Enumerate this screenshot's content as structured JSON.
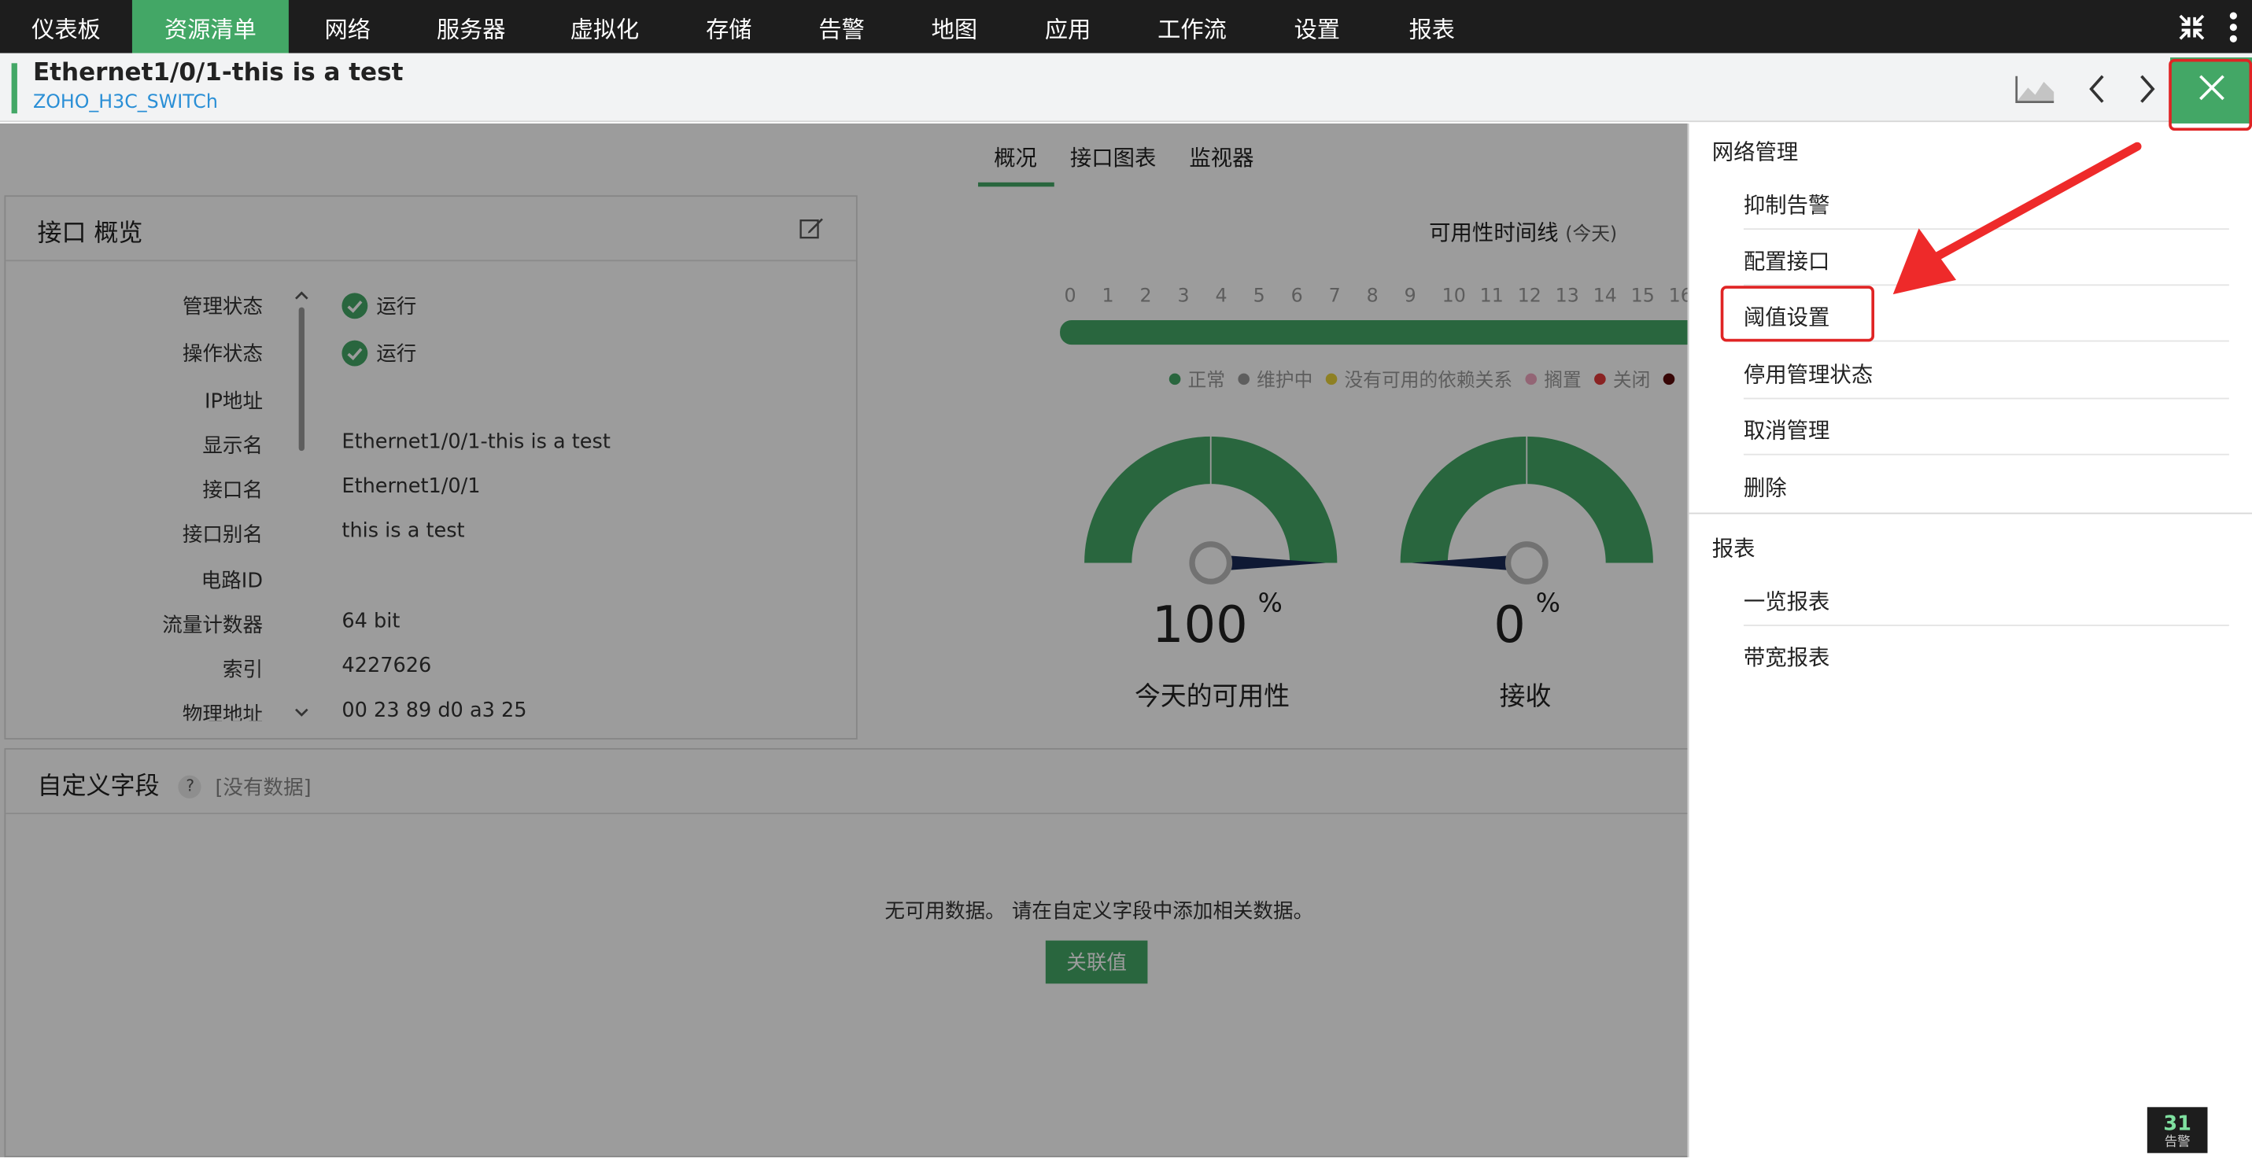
{
  "topnav": {
    "items": [
      "仪表板",
      "资源清单",
      "网络",
      "服务器",
      "虚拟化",
      "存储",
      "告警",
      "地图",
      "应用",
      "工作流",
      "设置",
      "报表"
    ],
    "active": "资源清单"
  },
  "header": {
    "title": "Ethernet1/0/1-this is a test",
    "subtitle": "ZOHO_H3C_SWITCh"
  },
  "tabs": [
    "概况",
    "接口图表",
    "监视器"
  ],
  "active_tab": "概况",
  "overview": {
    "title": "接口 概览",
    "properties": [
      {
        "label": "管理状态",
        "value": "运行",
        "ok": true
      },
      {
        "label": "操作状态",
        "value": "运行",
        "ok": true
      },
      {
        "label": "IP地址",
        "value": ""
      },
      {
        "label": "显示名",
        "value": "Ethernet1/0/1-this is a test"
      },
      {
        "label": "接口名",
        "value": "Ethernet1/0/1"
      },
      {
        "label": "接口别名",
        "value": "this is a test"
      },
      {
        "label": "电路ID",
        "value": ""
      },
      {
        "label": "流量计数器",
        "value": "64 bit"
      },
      {
        "label": "索引",
        "value": "4227626"
      },
      {
        "label": "物理地址",
        "value": "00 23 89 d0 a3 25"
      }
    ]
  },
  "availability": {
    "title": "可用性时间线",
    "period": "(今天)",
    "hours": [
      "0",
      "1",
      "2",
      "3",
      "4",
      "5",
      "6",
      "7",
      "8",
      "9",
      "10",
      "11",
      "12",
      "13",
      "14",
      "15",
      "16"
    ],
    "legend": [
      {
        "label": "正常",
        "color": "#43a766"
      },
      {
        "label": "维护中",
        "color": "#9a9a9a"
      },
      {
        "label": "没有可用的依赖关系",
        "color": "#e8d23a"
      },
      {
        "label": "搁置",
        "color": "#f0a6c0"
      },
      {
        "label": "关闭",
        "color": "#e23a3a"
      },
      {
        "label": "",
        "color": "#5a0a0a"
      }
    ]
  },
  "gauges": [
    {
      "value": "100",
      "unit": "%",
      "label": "今天的可用性",
      "fraction": 1.0
    },
    {
      "value": "0",
      "unit": "%",
      "label": "接收",
      "fraction": 0.0
    }
  ],
  "custom_fields": {
    "title": "自定义字段",
    "help": "?",
    "no_data_tag": "[没有数据]",
    "empty_message": "无可用数据。 请在自定义字段中添加相关数据。",
    "button": "关联值"
  },
  "panel": {
    "sections": [
      {
        "title": "网络管理",
        "items": [
          "抑制告警",
          "配置接口",
          "阈值设置",
          "停用管理状态",
          "取消管理",
          "删除"
        ]
      },
      {
        "title": "报表",
        "items": [
          "一览报表",
          "带宽报表"
        ]
      }
    ],
    "highlighted_item": "阈值设置"
  },
  "alarm_badge": {
    "count": "31",
    "label": "告警"
  },
  "colors": {
    "accent": "#43a766",
    "nav_bg": "#1d1d1d",
    "link": "#2a8fd6",
    "annotation": "#e02424"
  }
}
